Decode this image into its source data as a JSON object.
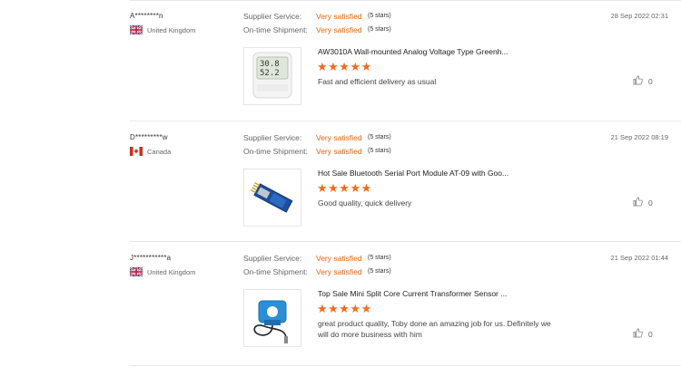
{
  "reviews": [
    {
      "user": "A********n",
      "country": "United Kingdom",
      "flag": "uk",
      "supplier_label": "Supplier Service:",
      "supplier_value": "Very satisfied",
      "supplier_stars": "(5 stars)",
      "shipment_label": "On-time Shipment:",
      "shipment_value": "Very satisfied",
      "shipment_stars": "(5 stars)",
      "date": "28 Sep 2022 02:31",
      "product": "AW3010A Wall-mounted Analog Voltage Type Greenh...",
      "rating": 5,
      "comment": "Fast and efficient delivery as usual",
      "likes": "0",
      "thumb_icon": "thermometer-device-icon"
    },
    {
      "user": "D*********w",
      "country": "Canada",
      "flag": "ca",
      "supplier_label": "Supplier Service:",
      "supplier_value": "Very satisfied",
      "supplier_stars": "(5 stars)",
      "shipment_label": "On-time Shipment:",
      "shipment_value": "Very satisfied",
      "shipment_stars": "(5 stars)",
      "date": "21 Sep 2022 08:19",
      "product": "Hot Sale Bluetooth Serial Port Module AT-09 with Goo...",
      "rating": 5,
      "comment": "Good quality, quick delivery",
      "likes": "0",
      "thumb_icon": "bluetooth-module-icon"
    },
    {
      "user": "J***********a",
      "country": "United Kingdom",
      "flag": "uk",
      "supplier_label": "Supplier Service:",
      "supplier_value": "Very satisfied",
      "supplier_stars": "(5 stars)",
      "shipment_label": "On-time Shipment:",
      "shipment_value": "Very satisfied",
      "shipment_stars": "(5 stars)",
      "date": "21 Sep 2022 01:44",
      "product": "Top Sale Mini Split Core Current Transformer Sensor ...",
      "rating": 5,
      "comment": "great product quality, Toby done an amazing job for us. Definitely we will do more business with him",
      "likes": "0",
      "thumb_icon": "current-transformer-icon"
    }
  ],
  "colors": {
    "accent": "#e8640c",
    "star": "#f36b1c"
  }
}
